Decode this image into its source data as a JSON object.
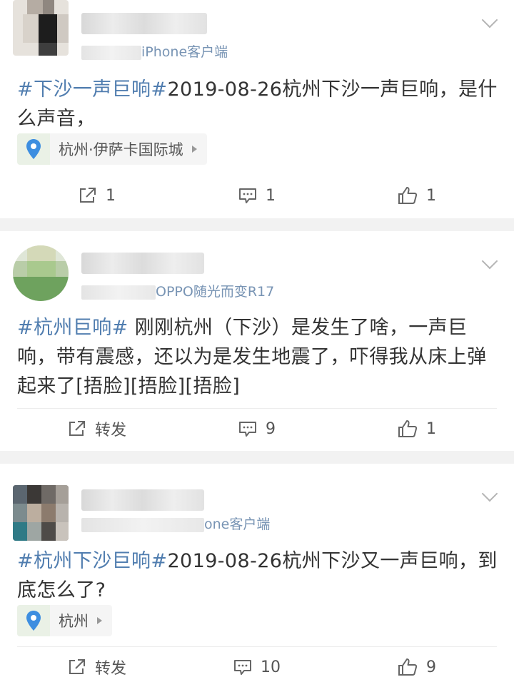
{
  "posts": [
    {
      "meta_visible": "iPhone客户端",
      "meta_prefix_visible": "刚刚 来自",
      "text_tag": "#下沙一声巨响#",
      "text_body": "2019-08-26杭州下沙一声巨响，是什么声音，",
      "location": "杭州·伊萨卡国际城",
      "actions": {
        "repost": "1",
        "comment": "1",
        "like": "1"
      }
    },
    {
      "meta_visible": "OPPO随光而变R17",
      "meta_prefix_visible": "刚刚 来自",
      "text_tag": "#杭州巨响#",
      "text_body": " 刚刚杭州（下沙）是发生了啥，一声巨响，带有震感，还以为是发生地震了，吓得我从床上弹起来了[捂脸][捂脸][捂脸]",
      "actions": {
        "repost": "转发",
        "comment": "9",
        "like": "1"
      }
    },
    {
      "meta_visible": "one客户端",
      "meta_prefix_visible": "刚刚 来自",
      "text_tag": "#杭州下沙巨响#",
      "text_body": "2019-08-26杭州下沙又一声巨响，到底怎么了?",
      "location": "杭州",
      "actions": {
        "repost": "转发",
        "comment": "10",
        "like": "9"
      }
    }
  ],
  "icons": {
    "repost": "share-icon",
    "comment": "comment-icon",
    "like": "thumbs-up-icon",
    "location": "location-pin-icon",
    "menu": "chevron-down-icon"
  },
  "colors": {
    "tag": "#507daf",
    "meta": "#7894b4",
    "text": "#333333",
    "background": "#f2f2f2",
    "pin": "#3d8ee0"
  }
}
